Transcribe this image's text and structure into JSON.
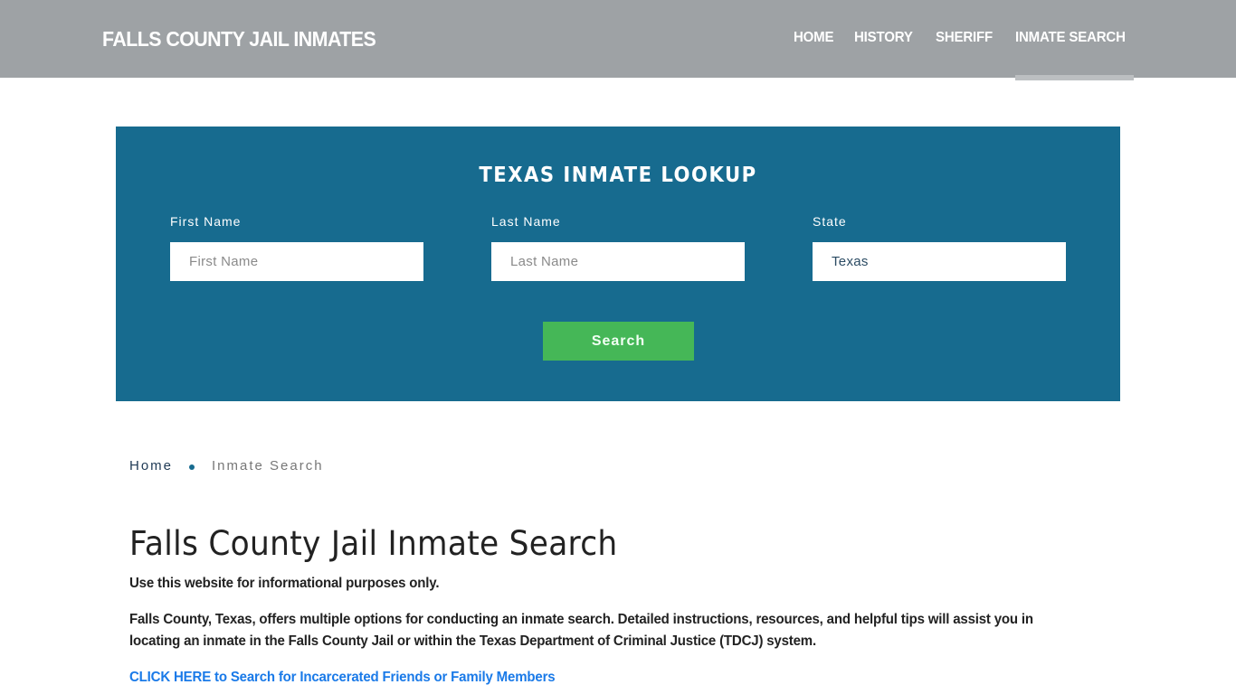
{
  "header": {
    "brand": "FALLS COUNTY JAIL INMATES",
    "nav": [
      {
        "label": "HOME",
        "active": false
      },
      {
        "label": "HISTORY",
        "active": false
      },
      {
        "label": "SHERIFF",
        "active": false
      },
      {
        "label": "INMATE SEARCH",
        "active": true
      }
    ]
  },
  "lookup": {
    "title": "TEXAS INMATE LOOKUP",
    "fields": [
      {
        "label": "First Name",
        "placeholder": "First Name",
        "value": ""
      },
      {
        "label": "Last Name",
        "placeholder": "Last Name",
        "value": ""
      },
      {
        "label": "State",
        "placeholder": "",
        "value": "Texas"
      }
    ],
    "search_label": "Search"
  },
  "breadcrumb": {
    "home": "Home",
    "current": "Inmate Search"
  },
  "content": {
    "title": "Falls County Jail Inmate Search",
    "disclaimer": "Use this website for informational purposes only.",
    "intro": "Falls County, Texas, offers multiple options for conducting an inmate search. Detailed instructions, resources, and helpful tips will assist you in locating an inmate in the Falls County Jail or within the Texas Department of Criminal Justice (TDCJ) system.",
    "cta": "CLICK HERE to Search for Incarcerated Friends or Family Members"
  },
  "colors": {
    "header_bg": "#9ea2a5",
    "lookup_bg": "#176b8f",
    "search_button": "#45b757",
    "link": "#1a7ae8"
  }
}
